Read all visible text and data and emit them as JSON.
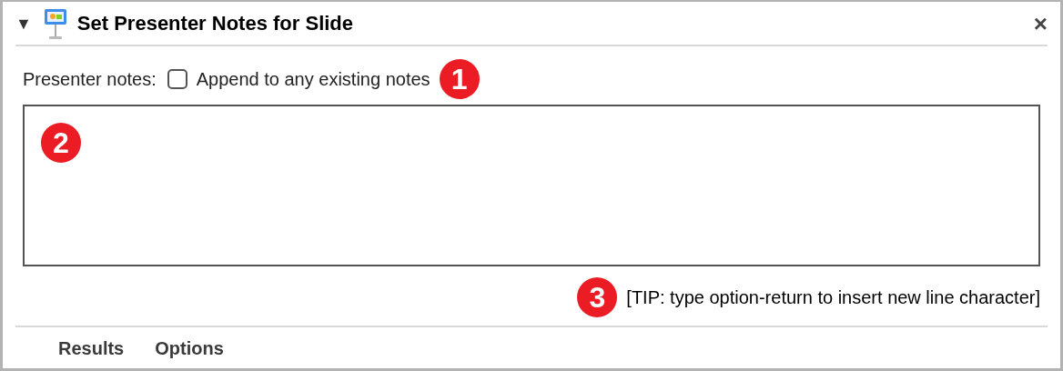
{
  "action": {
    "disclosure": "▼",
    "title": "Set Presenter Notes for Slide",
    "close": "×",
    "expanded": true
  },
  "notes_row": {
    "label": "Presenter notes:",
    "checkbox": {
      "label": "Append to any existing notes",
      "checked": false
    },
    "callout": "1"
  },
  "notes_field": {
    "callout": "2"
  },
  "tip": {
    "callout": "3",
    "text": "[TIP: type option-return to insert new line character]"
  },
  "tabs": [
    {
      "label": "Results",
      "selected": false
    },
    {
      "label": "Options",
      "selected": false
    }
  ]
}
